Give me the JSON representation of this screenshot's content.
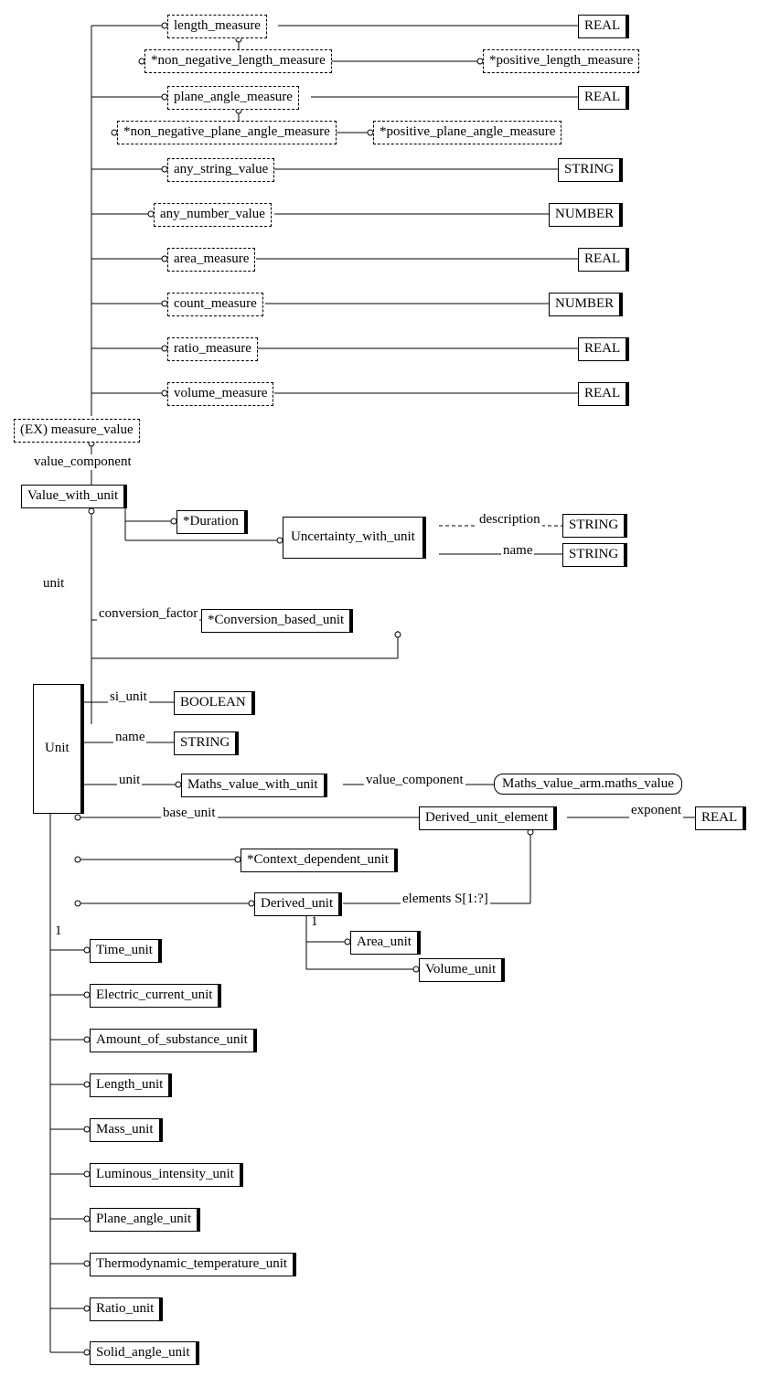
{
  "measures": {
    "length_measure": "length_measure",
    "non_negative_length_measure": "*non_negative_length_measure",
    "positive_length_measure": "*positive_length_measure",
    "plane_angle_measure": "plane_angle_measure",
    "non_negative_plane_angle_measure": "*non_negative_plane_angle_measure",
    "positive_plane_angle_measure": "*positive_plane_angle_measure",
    "any_string_value": "any_string_value",
    "any_number_value": "any_number_value",
    "area_measure": "area_measure",
    "count_measure": "count_measure",
    "ratio_measure": "ratio_measure",
    "volume_measure": "volume_measure",
    "ex_measure_value": "(EX) measure_value"
  },
  "types": {
    "real": "REAL",
    "string": "STRING",
    "number": "NUMBER",
    "boolean": "BOOLEAN"
  },
  "labels": {
    "value_component": "value_component",
    "unit": "unit",
    "conversion_factor": "conversion_factor",
    "si_unit": "si_unit",
    "name": "name",
    "description": "description",
    "base_unit": "base_unit",
    "exponent": "exponent",
    "elements": "elements S[1:?]",
    "one": "1"
  },
  "entities": {
    "value_with_unit": "Value_with_unit",
    "duration": "*Duration",
    "uncertainty_with_unit": "Uncertainty_with_unit",
    "conversion_based_unit": "*Conversion_based_unit",
    "unit": "Unit",
    "maths_value_with_unit": "Maths_value_with_unit",
    "maths_value_ref": "Maths_value_arm.maths_value",
    "derived_unit_element": "Derived_unit_element",
    "context_dependent_unit": "*Context_dependent_unit",
    "derived_unit": "Derived_unit",
    "area_unit": "Area_unit",
    "volume_unit": "Volume_unit",
    "time_unit": "Time_unit",
    "electric_current_unit": "Electric_current_unit",
    "amount_of_substance_unit": "Amount_of_substance_unit",
    "length_unit": "Length_unit",
    "mass_unit": "Mass_unit",
    "luminous_intensity_unit": "Luminous_intensity_unit",
    "plane_angle_unit": "Plane_angle_unit",
    "thermodynamic_temperature_unit": "Thermodynamic_temperature_unit",
    "ratio_unit": "Ratio_unit",
    "solid_angle_unit": "Solid_angle_unit"
  }
}
